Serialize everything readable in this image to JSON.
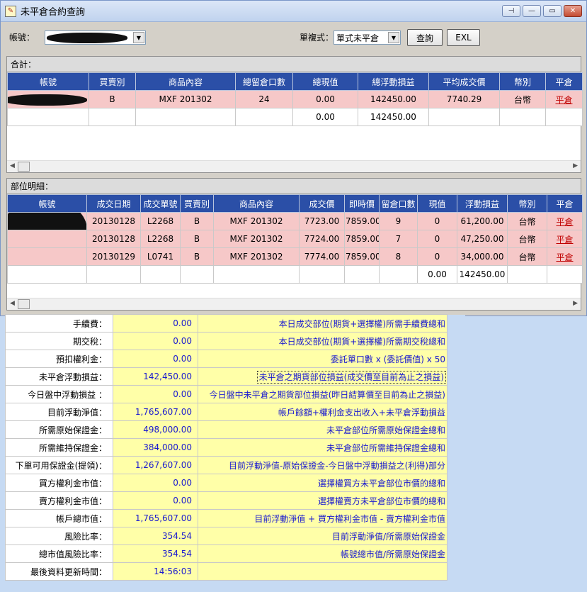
{
  "window": {
    "title": "未平倉合約查詢",
    "icon": "app-icon"
  },
  "toolbar": {
    "account_label": "帳號：",
    "mode_label": "單複式：",
    "mode_value": "單式未平倉",
    "query_label": "查詢",
    "excel_label": "EXL"
  },
  "totals": {
    "title": "合計：",
    "headers": [
      "帳號",
      "買賣別",
      "商品內容",
      "總留倉口數",
      "總現值",
      "總浮動損益",
      "平均成交價",
      "幣別",
      "平倉"
    ],
    "rows": [
      [
        "",
        "B",
        "MXF 201302",
        "24",
        "0.00",
        "142450.00",
        "7740.29",
        "台幣",
        "平倉"
      ],
      [
        "",
        "",
        "",
        "",
        "0.00",
        "142450.00",
        "",
        "",
        ""
      ]
    ]
  },
  "details": {
    "title": "部位明細：",
    "headers": [
      "帳號",
      "成交日期",
      "成交單號",
      "買賣別",
      "商品內容",
      "成交價",
      "即時價",
      "留倉口數",
      "現值",
      "浮動損益",
      "幣別",
      "平倉"
    ],
    "rows": [
      [
        "",
        "20130128",
        "L2268",
        "B",
        "MXF 201302",
        "7723.00",
        "7859.00",
        "9",
        "0",
        "61,200.00",
        "台幣",
        "平倉"
      ],
      [
        "",
        "20130128",
        "L2268",
        "B",
        "MXF 201302",
        "7724.00",
        "7859.00",
        "7",
        "0",
        "47,250.00",
        "台幣",
        "平倉"
      ],
      [
        "",
        "20130129",
        "L0741",
        "B",
        "MXF 201302",
        "7774.00",
        "7859.00",
        "8",
        "0",
        "34,000.00",
        "台幣",
        "平倉"
      ],
      [
        "",
        "",
        "",
        "",
        "",
        "",
        "",
        "",
        "0.00",
        "142450.00",
        "",
        ""
      ]
    ]
  },
  "summary": [
    {
      "label": "手續費：",
      "value": "0.00",
      "desc": "本日成交部位(期貨+選擇權)所需手續費總和"
    },
    {
      "label": "期交稅：",
      "value": "0.00",
      "desc": "本日成交部位(期貨+選擇權)所需期交稅總和"
    },
    {
      "label": "預扣權利金：",
      "value": "0.00",
      "desc": "委託單口數 x (委託價值) x 50"
    },
    {
      "label": "未平倉浮動損益：",
      "value": "142,450.00",
      "desc": "未平倉之期貨部位損益(成交價至目前為止之損益)"
    },
    {
      "label": "今日盤中浮動損益 ：",
      "value": "0.00",
      "desc": "今日盤中未平倉之期貨部位損益(昨日結算價至目前為止之損益)"
    },
    {
      "label": "目前浮動淨值：",
      "value": "1,765,607.00",
      "desc": "帳戶餘額+權利金支出收入+未平倉浮動損益"
    },
    {
      "label": "所需原始保證金：",
      "value": "498,000.00",
      "desc": "未平倉部位所需原始保證金總和"
    },
    {
      "label": "所需維持保證金：",
      "value": "384,000.00",
      "desc": "未平倉部位所需維持保證金總和"
    },
    {
      "label": "下單可用保證金(提領)：",
      "value": "1,267,607.00",
      "desc": "目前浮動淨值-原始保證金-今日盤中浮動損益之(利得)部分"
    },
    {
      "label": "買方權利金市值：",
      "value": "0.00",
      "desc": "選擇權買方未平倉部位市價的總和"
    },
    {
      "label": "賣方權利金市值：",
      "value": "0.00",
      "desc": "選擇權賣方未平倉部位市價的總和"
    },
    {
      "label": "帳戶總市值：",
      "value": "1,765,607.00",
      "desc": "目前浮動淨值 + 買方權利金市值 - 賣方權利金市值"
    },
    {
      "label": "風險比率：",
      "value": "354.54",
      "desc": "目前浮動淨值/所需原始保證金"
    },
    {
      "label": "總市值風險比率：",
      "value": "354.54",
      "desc": "帳號總市值/所需原始保證金"
    },
    {
      "label": "最後資料更新時間：",
      "value": "14:56:03",
      "desc": ""
    }
  ]
}
